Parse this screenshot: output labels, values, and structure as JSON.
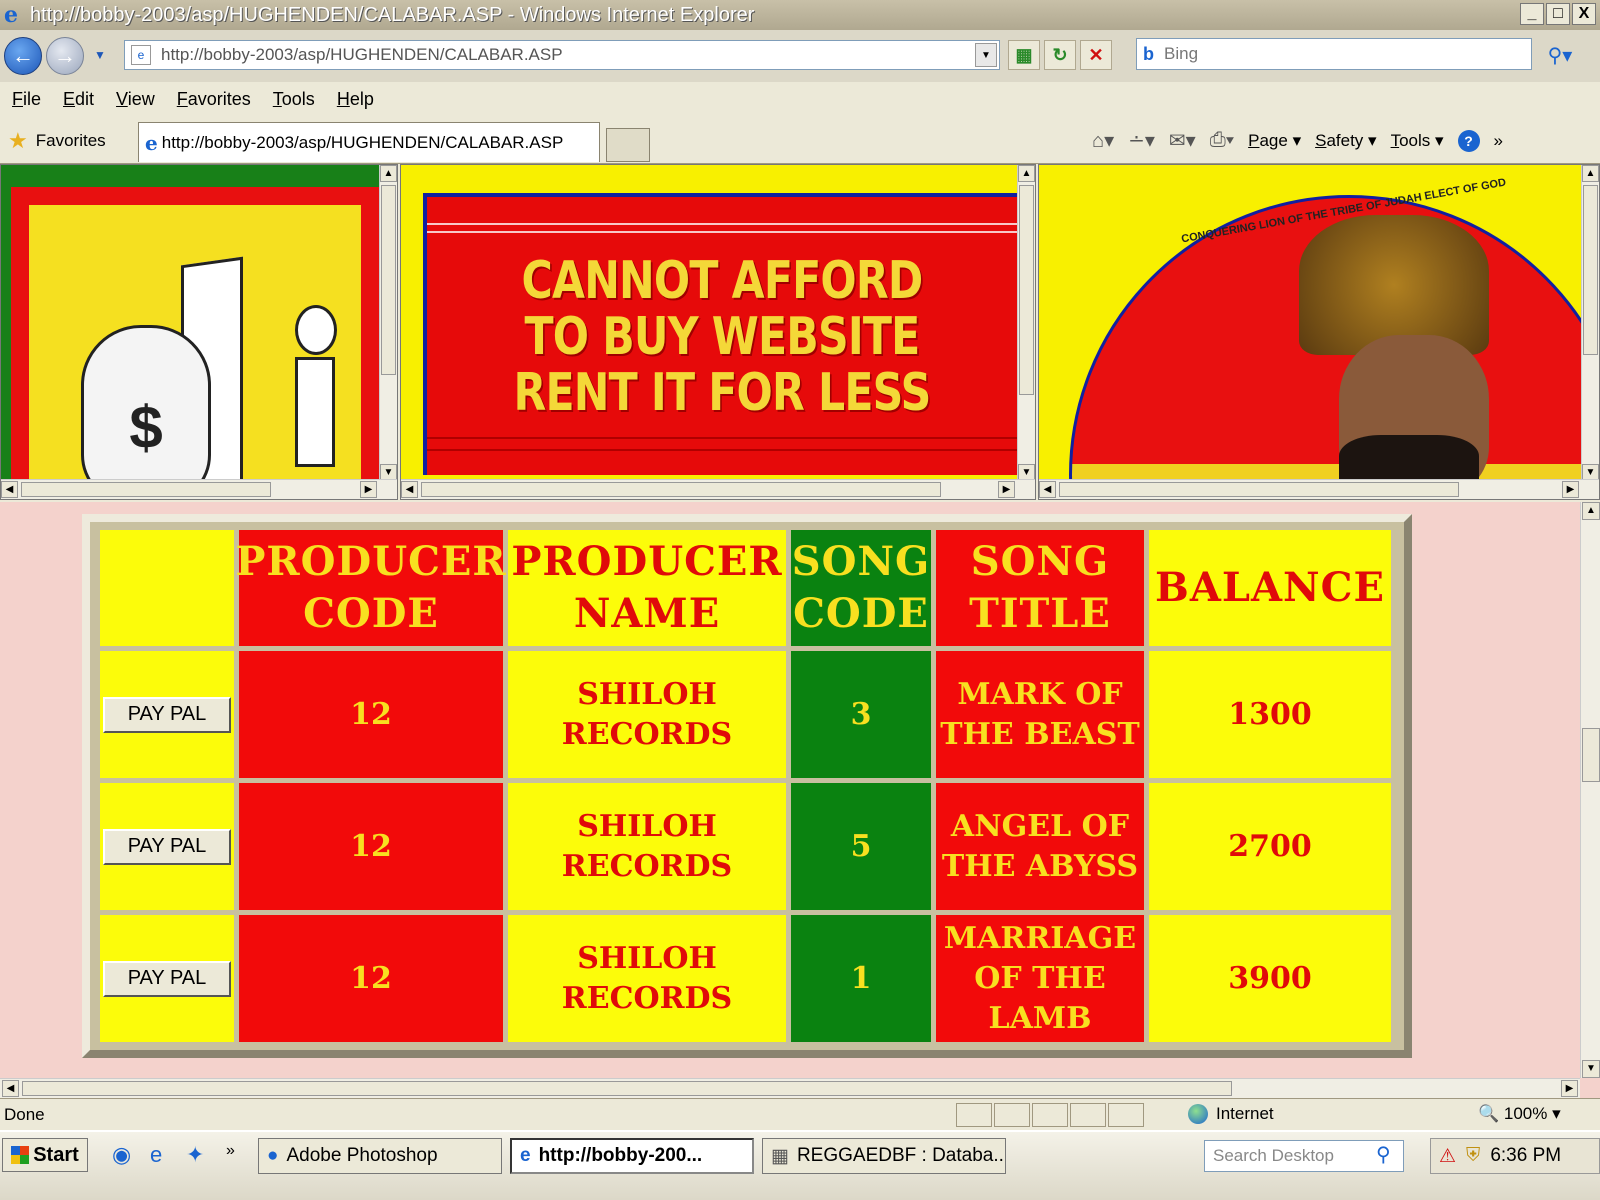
{
  "window": {
    "title": "http://bobby-2003/asp/HUGHENDEN/CALABAR.ASP - Windows Internet Explorer",
    "min": "_",
    "max": "□",
    "close": "X"
  },
  "address_bar": {
    "url": "http://bobby-2003/asp/HUGHENDEN/CALABAR.ASP",
    "search_placeholder": "Bing",
    "search_brand": "b"
  },
  "menu": [
    "File",
    "Edit",
    "View",
    "Favorites",
    "Tools",
    "Help"
  ],
  "favorites_bar": {
    "favorites_label": "Favorites",
    "tab_title": "http://bobby-2003/asp/HUGHENDEN/CALABAR.ASP",
    "commands": [
      "Page",
      "Safety",
      "Tools"
    ]
  },
  "banner": {
    "line1": "CANNOT AFFORD",
    "line2": "TO BUY WEBSITE",
    "line3": "RENT IT FOR LESS"
  },
  "portrait": {
    "ring_text": "CONQUERING LION OF THE TRIBE OF JUDAH ELECT OF GOD"
  },
  "table": {
    "headers": {
      "producer_code": "PRODUCER CODE",
      "producer_name": "PRODUCER NAME",
      "song_code": "SONG CODE",
      "song_title": "SONG TITLE",
      "balance": "BALANCE"
    },
    "button_label": "PAY PAL",
    "rows": [
      {
        "producer_code": "12",
        "producer_name": "SHILOH RECORDS",
        "song_code": "3",
        "song_title": "MARK OF THE BEAST",
        "balance": "1300"
      },
      {
        "producer_code": "12",
        "producer_name": "SHILOH RECORDS",
        "song_code": "5",
        "song_title": "ANGEL OF THE ABYSS",
        "balance": "2700"
      },
      {
        "producer_code": "12",
        "producer_name": "SHILOH RECORDS",
        "song_code": "1",
        "song_title": "MARRIAGE OF THE LAMB",
        "balance": "3900"
      }
    ]
  },
  "status_bar": {
    "status": "Done",
    "zone": "Internet",
    "zoom": "100%"
  },
  "taskbar": {
    "start": "Start",
    "tasks": [
      "Adobe Photoshop",
      "http://bobby-200...",
      "REGGAEDBF : Databa..."
    ],
    "search_placeholder": "Search Desktop",
    "clock": "6:36 PM"
  },
  "colors": {
    "red": "#f20a0a",
    "yellow": "#fcfc0a",
    "green": "#0a8210",
    "page_bg": "#f4d2cc"
  }
}
